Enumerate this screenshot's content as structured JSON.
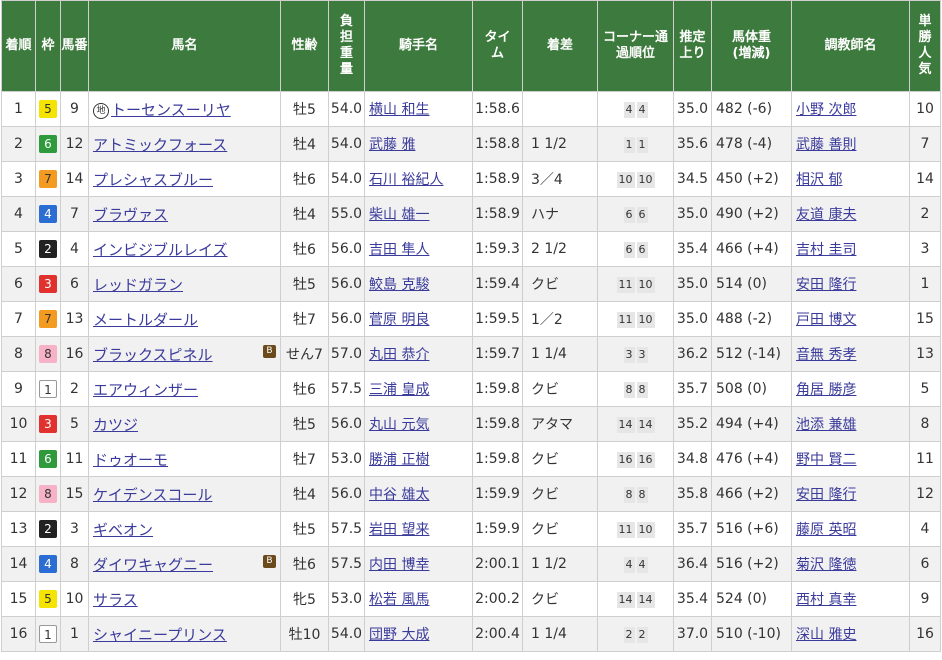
{
  "headers": {
    "rank": "着順",
    "waku": "枠",
    "umaban": "馬番",
    "horse": "馬名",
    "sexage": "性齢",
    "weight": "負担重量",
    "jockey": "騎手名",
    "time": "タイム",
    "margin": "着差",
    "corner": "コーナー通過順位",
    "last3f": "推定上り",
    "bodyweight_main": "馬体重",
    "bodyweight_sub": "(増減)",
    "trainer": "調教師名",
    "pop": "単勝人気"
  },
  "badges": {
    "chihou": "地",
    "blinker": "B"
  },
  "waku_colors": {
    "1": "#ffffff",
    "2": "#222222",
    "3": "#e0312e",
    "4": "#2b6dd3",
    "5": "#f5e400",
    "6": "#2e9a3c",
    "7": "#f39a21",
    "8": "#f7b2c8"
  },
  "rows": [
    {
      "rank": "1",
      "waku": "5",
      "umaban": "9",
      "horse": "トーセンスーリヤ",
      "chihou": true,
      "blinker": false,
      "sexage": "牡5",
      "weight": "54.0",
      "jockey": "横山 和生",
      "time": "1:58.6",
      "margin": "",
      "c1": "4",
      "c2": "4",
      "last3f": "35.0",
      "bw": "482 (-6)",
      "trainer": "小野 次郎",
      "pop": "10"
    },
    {
      "rank": "2",
      "waku": "6",
      "umaban": "12",
      "horse": "アトミックフォース",
      "chihou": false,
      "blinker": false,
      "sexage": "牡4",
      "weight": "54.0",
      "jockey": "武藤 雅",
      "time": "1:58.8",
      "margin": "1 1/2",
      "c1": "1",
      "c2": "1",
      "last3f": "35.6",
      "bw": "478 (-4)",
      "trainer": "武藤 善則",
      "pop": "7"
    },
    {
      "rank": "3",
      "waku": "7",
      "umaban": "14",
      "horse": "プレシャスブルー",
      "chihou": false,
      "blinker": false,
      "sexage": "牡6",
      "weight": "54.0",
      "jockey": "石川 裕紀人",
      "time": "1:58.9",
      "margin": "3／4",
      "c1": "10",
      "c2": "10",
      "last3f": "34.5",
      "bw": "450 (+2)",
      "trainer": "相沢 郁",
      "pop": "14"
    },
    {
      "rank": "4",
      "waku": "4",
      "umaban": "7",
      "horse": "ブラヴァス",
      "chihou": false,
      "blinker": false,
      "sexage": "牡4",
      "weight": "55.0",
      "jockey": "柴山 雄一",
      "time": "1:58.9",
      "margin": "ハナ",
      "c1": "6",
      "c2": "6",
      "last3f": "35.0",
      "bw": "490 (+2)",
      "trainer": "友道 康夫",
      "pop": "2"
    },
    {
      "rank": "5",
      "waku": "2",
      "umaban": "4",
      "horse": "インビジブルレイズ",
      "chihou": false,
      "blinker": false,
      "sexage": "牡6",
      "weight": "56.0",
      "jockey": "吉田 隼人",
      "time": "1:59.3",
      "margin": "2 1/2",
      "c1": "6",
      "c2": "6",
      "last3f": "35.4",
      "bw": "466 (+4)",
      "trainer": "吉村 圭司",
      "pop": "3"
    },
    {
      "rank": "6",
      "waku": "3",
      "umaban": "6",
      "horse": "レッドガラン",
      "chihou": false,
      "blinker": false,
      "sexage": "牡5",
      "weight": "56.0",
      "jockey": "鮫島 克駿",
      "time": "1:59.4",
      "margin": "クビ",
      "c1": "11",
      "c2": "10",
      "last3f": "35.0",
      "bw": "514 (0)",
      "trainer": "安田 隆行",
      "pop": "1"
    },
    {
      "rank": "7",
      "waku": "7",
      "umaban": "13",
      "horse": "メートルダール",
      "chihou": false,
      "blinker": false,
      "sexage": "牡7",
      "weight": "56.0",
      "jockey": "菅原 明良",
      "time": "1:59.5",
      "margin": "1／2",
      "c1": "11",
      "c2": "10",
      "last3f": "35.0",
      "bw": "488 (-2)",
      "trainer": "戸田 博文",
      "pop": "15"
    },
    {
      "rank": "8",
      "waku": "8",
      "umaban": "16",
      "horse": "ブラックスピネル",
      "chihou": false,
      "blinker": true,
      "sexage": "せん7",
      "weight": "57.0",
      "jockey": "丸田 恭介",
      "time": "1:59.7",
      "margin": "1 1/4",
      "c1": "3",
      "c2": "3",
      "last3f": "36.2",
      "bw": "512 (-14)",
      "trainer": "音無 秀孝",
      "pop": "13"
    },
    {
      "rank": "9",
      "waku": "1",
      "umaban": "2",
      "horse": "エアウィンザー",
      "chihou": false,
      "blinker": false,
      "sexage": "牡6",
      "weight": "57.5",
      "jockey": "三浦 皇成",
      "time": "1:59.8",
      "margin": "クビ",
      "c1": "8",
      "c2": "8",
      "last3f": "35.7",
      "bw": "508 (0)",
      "trainer": "角居 勝彦",
      "pop": "5"
    },
    {
      "rank": "10",
      "waku": "3",
      "umaban": "5",
      "horse": "カツジ",
      "chihou": false,
      "blinker": false,
      "sexage": "牡5",
      "weight": "56.0",
      "jockey": "丸山 元気",
      "time": "1:59.8",
      "margin": "アタマ",
      "c1": "14",
      "c2": "14",
      "last3f": "35.2",
      "bw": "494 (+4)",
      "trainer": "池添 兼雄",
      "pop": "8"
    },
    {
      "rank": "11",
      "waku": "6",
      "umaban": "11",
      "horse": "ドゥオーモ",
      "chihou": false,
      "blinker": false,
      "sexage": "牡7",
      "weight": "53.0",
      "jockey": "勝浦 正樹",
      "time": "1:59.8",
      "margin": "クビ",
      "c1": "16",
      "c2": "16",
      "last3f": "34.8",
      "bw": "476 (+4)",
      "trainer": "野中 賢二",
      "pop": "11"
    },
    {
      "rank": "12",
      "waku": "8",
      "umaban": "15",
      "horse": "ケイデンスコール",
      "chihou": false,
      "blinker": false,
      "sexage": "牡4",
      "weight": "56.0",
      "jockey": "中谷 雄太",
      "time": "1:59.9",
      "margin": "クビ",
      "c1": "8",
      "c2": "8",
      "last3f": "35.8",
      "bw": "466 (+2)",
      "trainer": "安田 隆行",
      "pop": "12"
    },
    {
      "rank": "13",
      "waku": "2",
      "umaban": "3",
      "horse": "ギベオン",
      "chihou": false,
      "blinker": false,
      "sexage": "牡5",
      "weight": "57.5",
      "jockey": "岩田 望来",
      "time": "1:59.9",
      "margin": "クビ",
      "c1": "11",
      "c2": "10",
      "last3f": "35.7",
      "bw": "516 (+6)",
      "trainer": "藤原 英昭",
      "pop": "4"
    },
    {
      "rank": "14",
      "waku": "4",
      "umaban": "8",
      "horse": "ダイワキャグニー",
      "chihou": false,
      "blinker": true,
      "sexage": "牡6",
      "weight": "57.5",
      "jockey": "内田 博幸",
      "time": "2:00.1",
      "margin": "1 1/2",
      "c1": "4",
      "c2": "4",
      "last3f": "36.4",
      "bw": "516 (+2)",
      "trainer": "菊沢 隆徳",
      "pop": "6"
    },
    {
      "rank": "15",
      "waku": "5",
      "umaban": "10",
      "horse": "サラス",
      "chihou": false,
      "blinker": false,
      "sexage": "牝5",
      "weight": "53.0",
      "jockey": "松若 風馬",
      "time": "2:00.2",
      "margin": "クビ",
      "c1": "14",
      "c2": "14",
      "last3f": "35.4",
      "bw": "524 (0)",
      "trainer": "西村 真幸",
      "pop": "9"
    },
    {
      "rank": "16",
      "waku": "1",
      "umaban": "1",
      "horse": "シャイニープリンス",
      "chihou": false,
      "blinker": false,
      "sexage": "牡10",
      "weight": "54.0",
      "jockey": "団野 大成",
      "time": "2:00.4",
      "margin": "1 1/4",
      "c1": "2",
      "c2": "2",
      "last3f": "37.0",
      "bw": "510 (-10)",
      "trainer": "深山 雅史",
      "pop": "16"
    }
  ]
}
